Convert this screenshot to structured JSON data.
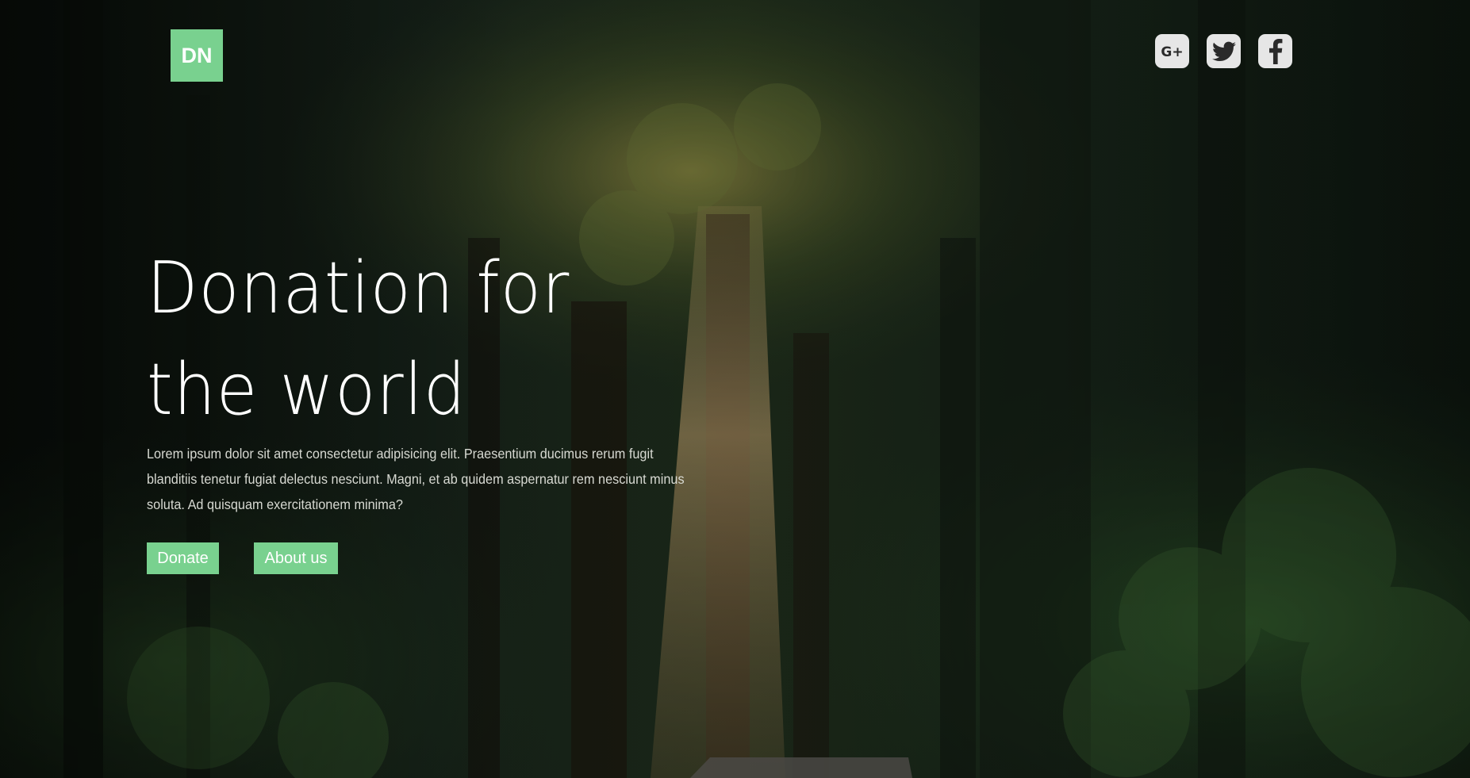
{
  "logo": {
    "text": "DN"
  },
  "social": [
    {
      "name": "google-plus-icon",
      "glyph": "G+"
    },
    {
      "name": "twitter-icon"
    },
    {
      "name": "facebook-icon"
    }
  ],
  "hero": {
    "title": "Donation for the world",
    "description": "Lorem ipsum dolor sit amet consectetur adipisicing elit. Praesentium ducimus rerum fugit blanditiis tenetur fugiat delectus nesciunt. Magni, et ab quidem aspernatur rem nesciunt minus soluta. Ad quisquam exercitationem minima?",
    "donate_label": "Donate",
    "about_label": "About us"
  },
  "colors": {
    "accent": "#79d18f",
    "icon_bg": "#e6e6e6",
    "text": "#ffffff"
  }
}
